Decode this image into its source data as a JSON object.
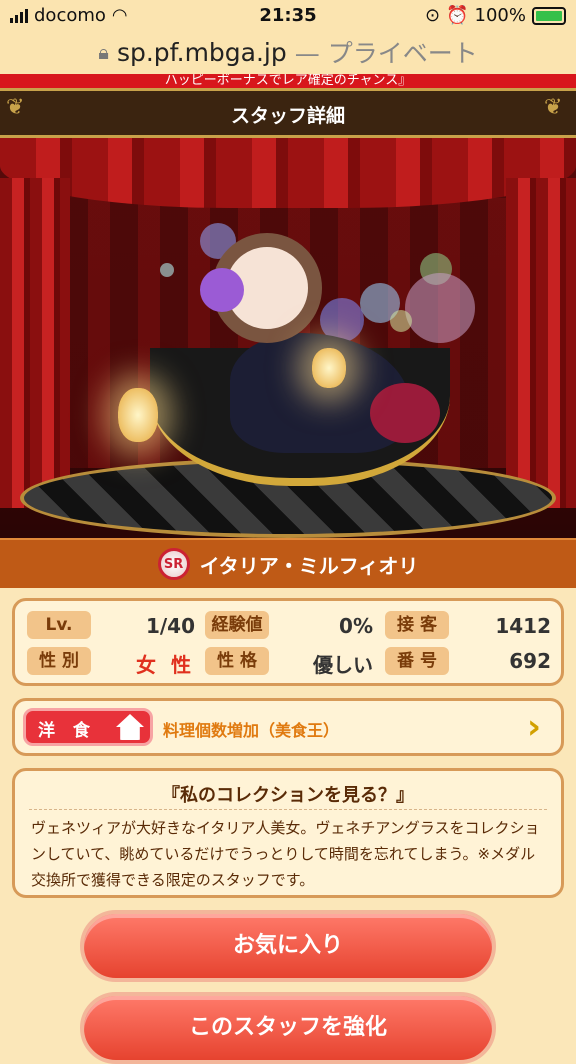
{
  "status_bar": {
    "carrier": "docomo",
    "time": "21:35",
    "battery": "100%"
  },
  "url_bar": {
    "domain": "sp.pf.mbga.jp",
    "label": "— プライベート"
  },
  "banner": {
    "text": "ハッピーボーナスでレア確定のチャンス』"
  },
  "title_bar": {
    "title": "スタッフ詳細"
  },
  "staff": {
    "rarity": "SR",
    "name": "イタリア・ミルフィオリ"
  },
  "stats": {
    "lv_label": "Lv.",
    "lv_value": "1/40",
    "exp_label": "経験値",
    "exp_value": "0%",
    "service_label": "接 客",
    "service_value": "1412",
    "gender_label": "性 別",
    "gender_value": "女 性",
    "personality_label": "性 格",
    "personality_value": "優しい",
    "number_label": "番 号",
    "number_value": "692"
  },
  "skill": {
    "category": "洋 食",
    "description": "料理個数増加（美食王）"
  },
  "description": {
    "quote": "『私のコレクションを見る？』",
    "body": "ヴェネツィアが大好きなイタリア人美女。ヴェネチアングラスをコレクションしていて、眺めているだけでうっとりして時間を忘れてしまう。※メダル交換所で獲得できる限定のスタッフです。"
  },
  "buttons": {
    "favorite": "お気に入り",
    "enhance": "このスタッフを強化"
  },
  "colors": {
    "accent_red": "#e8323a",
    "gold": "#c8a24a",
    "name_bar": "#bf5a16"
  }
}
